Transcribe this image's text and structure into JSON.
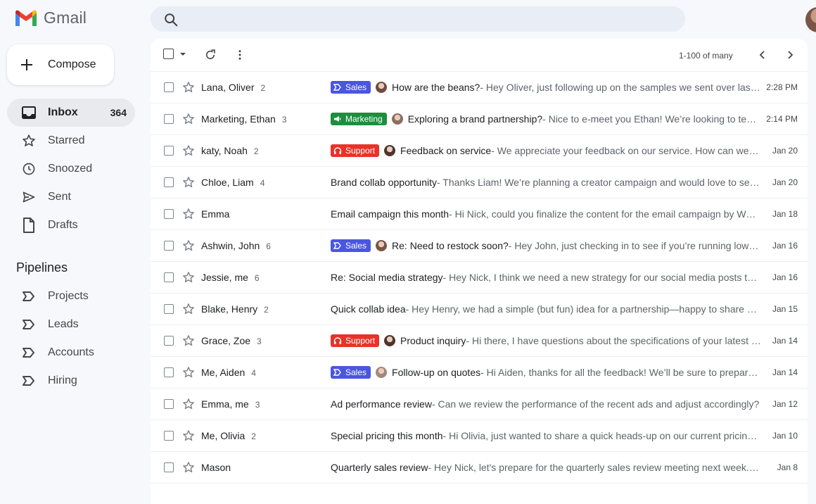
{
  "app": {
    "name": "Gmail"
  },
  "compose": {
    "label": "Compose"
  },
  "nav": [
    {
      "label": "Inbox",
      "count": "364",
      "icon": "inbox-icon"
    },
    {
      "label": "Starred",
      "icon": "star-icon"
    },
    {
      "label": "Snoozed",
      "icon": "clock-icon"
    },
    {
      "label": "Sent",
      "icon": "send-icon"
    },
    {
      "label": "Drafts",
      "icon": "draft-icon"
    }
  ],
  "pipelines": {
    "title": "Pipelines",
    "items": [
      {
        "label": "Projects"
      },
      {
        "label": "Leads"
      },
      {
        "label": "Accounts"
      },
      {
        "label": "Hiring"
      }
    ]
  },
  "toolbar": {
    "pager": "1-100 of many"
  },
  "colors": {
    "sales": "#4a56e0",
    "marketing": "#1e8e3e",
    "support": "#e8322a"
  },
  "emails": [
    {
      "sender": "Lana, Oliver",
      "count": "2",
      "label": "Sales",
      "label_type": "sales",
      "avatar": true,
      "subject": "How are the beans?",
      "snippet": " - Hey Oliver, just following up on the samples we sent over last week",
      "date": "2:28 PM"
    },
    {
      "sender": "Marketing, Ethan",
      "count": "3",
      "label": "Marketing",
      "label_type": "marketing",
      "avatar": true,
      "subject": "Exploring a brand partnership?",
      "snippet": " - Nice to e-meet you Ethan! We’re looking to team up",
      "date": "2:14 PM"
    },
    {
      "sender": "katy, Noah",
      "count": "2",
      "label": "Support",
      "label_type": "support",
      "avatar": true,
      "subject": "Feedback on service",
      "snippet": " - We appreciate your feedback on our service. How can we improve",
      "date": "Jan 20"
    },
    {
      "sender": "Chloe, Liam",
      "count": "4",
      "label": "",
      "label_type": "",
      "avatar": false,
      "subject": "Brand collab opportunity",
      "snippet": " - Thanks Liam! We’re planning a creator campaign and would love to send you",
      "date": "Jan 20"
    },
    {
      "sender": "Emma",
      "count": "",
      "label": "",
      "label_type": "",
      "avatar": false,
      "subject": "Email campaign this month",
      "snippet": " - Hi Nick, could you finalize the content for the email campaign by Wednesday",
      "date": "Jan 18"
    },
    {
      "sender": "Ashwin, John",
      "count": "6",
      "label": "Sales",
      "label_type": "sales",
      "avatar": true,
      "subject": "Re: Need to restock soon?",
      "snippet": " - Hey John, just checking in to see if you’re running low on",
      "date": "Jan 16"
    },
    {
      "sender": "Jessie, me",
      "count": "6",
      "label": "",
      "label_type": "",
      "avatar": false,
      "subject": "Re: Social media strategy",
      "snippet": " - Hey Nick, I think we need a new strategy for our social media posts this quarter",
      "date": "Jan 16"
    },
    {
      "sender": "Blake, Henry",
      "count": "2",
      "label": "",
      "label_type": "",
      "avatar": false,
      "subject": "Quick collab idea",
      "snippet": " - Hey Henry, we had a simple (but fun) idea for a partnership—happy to share more",
      "date": "Jan 15"
    },
    {
      "sender": "Grace, Zoe",
      "count": "3",
      "label": "Support",
      "label_type": "support",
      "avatar": true,
      "subject": "Product inquiry",
      "snippet": " - Hi there, I have questions about the specifications of your latest model",
      "date": "Jan 14"
    },
    {
      "sender": "Me, Aiden",
      "count": "4",
      "label": "Sales",
      "label_type": "sales",
      "avatar": true,
      "subject": "Follow-up on quotes",
      "snippet": " - Hi Aiden, thanks for all the feedback! We’ll be sure to prepare a new quote",
      "date": "Jan 14"
    },
    {
      "sender": "Emma, me",
      "count": "3",
      "label": "",
      "label_type": "",
      "avatar": false,
      "subject": "Ad performance review",
      "snippet": " - Can we review the performance of the recent ads and adjust accordingly?",
      "date": "Jan 12"
    },
    {
      "sender": "Me, Olivia",
      "count": "2",
      "label": "",
      "label_type": "",
      "avatar": false,
      "subject": "Special pricing this month",
      "snippet": " - Hi Olivia, just wanted to share a quick heads-up on our current pricing—",
      "date": "Jan 10"
    },
    {
      "sender": "Mason",
      "count": "",
      "label": "",
      "label_type": "",
      "avatar": false,
      "subject": "Quarterly sales review",
      "snippet": " - Hey Nick, let's prepare for the quarterly sales review meeting next week. Could you",
      "date": "Jan 8"
    }
  ]
}
